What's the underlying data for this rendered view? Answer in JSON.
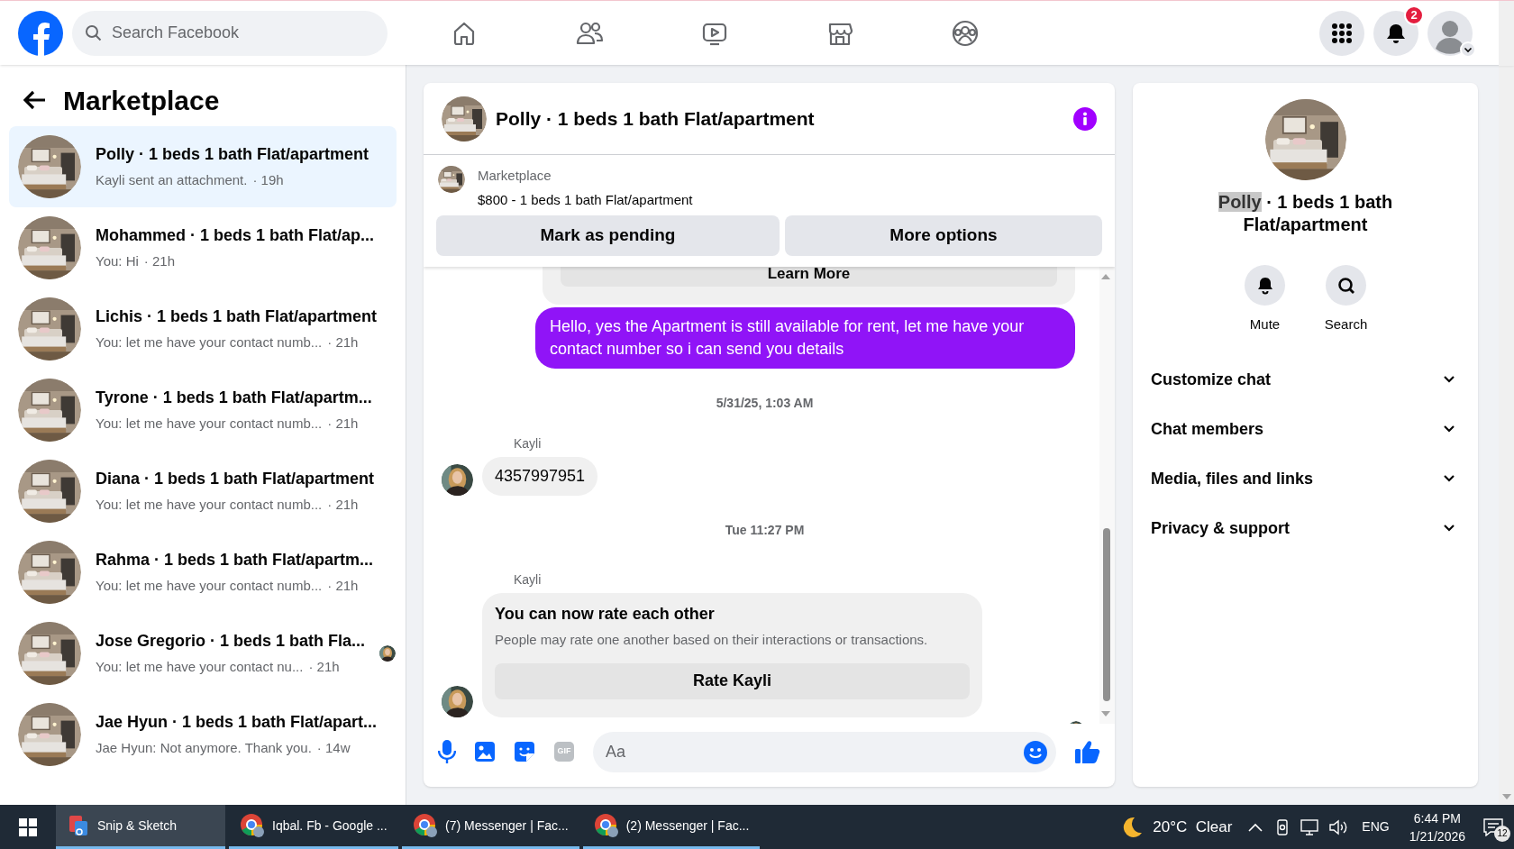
{
  "top_bar": {
    "search": {
      "placeholder": "Search Facebook"
    },
    "nav": [
      {
        "selected": false
      },
      {
        "selected": false
      },
      {
        "selected": false
      },
      {
        "selected": false
      },
      {
        "selected": false
      }
    ],
    "notifications_badge": "2"
  },
  "sidebar": {
    "title": "Marketplace",
    "conversations": [
      {
        "name": "Polly · 1 beds 1 bath Flat/apartment",
        "preview": "Kayli sent an attachment.",
        "time": "· 19h",
        "selected": true,
        "seen": false
      },
      {
        "name": "Mohammed · 1 beds 1 bath Flat/ap...",
        "preview": "You: Hi",
        "time": "· 21h",
        "selected": false,
        "seen": false
      },
      {
        "name": "Lichis · 1 beds 1 bath Flat/apartment",
        "preview": "You: let me have your contact numb...",
        "time": "· 21h",
        "selected": false,
        "seen": false
      },
      {
        "name": "Tyrone · 1 beds 1 bath Flat/apartm...",
        "preview": "You: let me have your contact numb...",
        "time": "· 21h",
        "selected": false,
        "seen": false
      },
      {
        "name": "Diana · 1 beds 1 bath Flat/apartment",
        "preview": "You: let me have your contact numb...",
        "time": "· 21h",
        "selected": false,
        "seen": false
      },
      {
        "name": "Rahma · 1 beds 1 bath Flat/apartm...",
        "preview": "You: let me have your contact numb...",
        "time": "· 21h",
        "selected": false,
        "seen": false
      },
      {
        "name": "Jose Gregorio · 1 beds 1 bath Fla...",
        "preview": "You: let me have your contact nu...",
        "time": "· 21h",
        "selected": false,
        "seen": true
      },
      {
        "name": "Jae Hyun · 1 beds 1 bath Flat/apart...",
        "preview": "Jae Hyun: Not anymore. Thank you.",
        "time": "· 14w",
        "selected": false,
        "seen": false
      }
    ]
  },
  "chat": {
    "title": "Polly · 1 beds 1 bath Flat/apartment",
    "listing": {
      "source": "Marketplace",
      "summary": "$800 - 1 beds 1 bath Flat/apartment"
    },
    "buttons": [
      "Mark as pending",
      "More options"
    ],
    "messages": [
      {
        "kind": "card_button",
        "text": "Learn More"
      },
      {
        "kind": "outgoing",
        "text": "Hello, yes the Apartment is still available for rent, let me have your contact number so i can send you details"
      },
      {
        "kind": "timestamp",
        "text": "5/31/25, 1:03 AM"
      },
      {
        "kind": "incoming",
        "sender": "Kayli",
        "text": "4357997951"
      },
      {
        "kind": "timestamp",
        "text": "Tue 11:27 PM"
      },
      {
        "kind": "rate_card",
        "sender": "Kayli",
        "title": "You can now rate each other",
        "body": "People may rate one another based on their interactions or transactions.",
        "button": "Rate Kayli"
      }
    ],
    "composer": {
      "placeholder": "Aa",
      "gif_label": "GIF"
    }
  },
  "details": {
    "title_name": "Polly",
    "title_rest": " · 1 beds 1 bath Flat/apartment",
    "name_highlighted": true,
    "actions": [
      {
        "label": "Mute"
      },
      {
        "label": "Search"
      }
    ],
    "sections": [
      {
        "label": "Customize chat",
        "expanded": false
      },
      {
        "label": "Chat members",
        "expanded": false
      },
      {
        "label": "Media, files and links",
        "expanded": false
      },
      {
        "label": "Privacy & support",
        "expanded": false
      }
    ]
  },
  "taskbar": {
    "apps": [
      {
        "label": "Snip & Sketch",
        "selected": true
      },
      {
        "label": "Iqbal. Fb - Google ...",
        "selected": false
      },
      {
        "label": "(7) Messenger | Fac...",
        "selected": false
      },
      {
        "label": "(2) Messenger | Fac...",
        "selected": false
      }
    ],
    "weather": "20°C  Clear",
    "language": "ENG",
    "time": "6:44 PM",
    "date": "1/21/2026",
    "notification_count": "12"
  }
}
